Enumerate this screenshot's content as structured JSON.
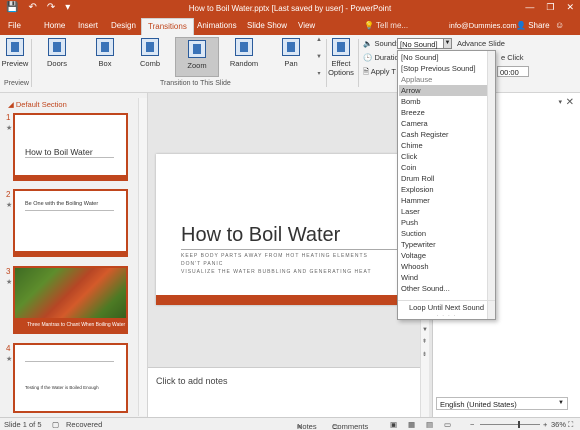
{
  "window": {
    "title": "How to Boil Water.pptx [Last saved by user] - PowerPoint",
    "controls": [
      "—",
      "❐",
      "✕"
    ]
  },
  "qat": {
    "save": "💾",
    "undo": "↶",
    "redo": "↷",
    "customize": "▾"
  },
  "tabs": [
    "File",
    "Home",
    "Insert",
    "Design",
    "Transitions",
    "Animations",
    "Slide Show",
    "View"
  ],
  "active_tab": "Transitions",
  "tell_me": "Tell me...",
  "account_email": "info@Dummies.com",
  "share_label": "Share",
  "ribbon": {
    "preview_label": "Preview",
    "preview_group_label": "Preview",
    "transitions": [
      "Doors",
      "Box",
      "Comb",
      "Zoom",
      "Random",
      "Pan"
    ],
    "selected_transition": "Zoom",
    "effect_options_label": "Effect Options",
    "group_label": "Transition to This Slide",
    "sound_label": "Sound:",
    "sound_value": "[No Sound]",
    "duration_label": "Duration",
    "apply_label": "Apply T",
    "advance_label": "Advance Slide",
    "click_label": "e Click",
    "time_value": "00:00"
  },
  "sound_dropdown": {
    "items": [
      "[No Sound]",
      "[Stop Previous Sound]",
      "Applause",
      "Arrow",
      "Bomb",
      "Breeze",
      "Camera",
      "Cash Register",
      "Chime",
      "Click",
      "Coin",
      "Drum Roll",
      "Explosion",
      "Hammer",
      "Laser",
      "Push",
      "Suction",
      "Typewriter",
      "Voltage",
      "Whoosh",
      "Wind",
      "Other Sound..."
    ],
    "highlighted": "Arrow",
    "loop_label": "Loop Until Next Sound"
  },
  "slides_pane": {
    "section": "Default Section",
    "slides": [
      {
        "num": "1",
        "title": "How to Boil Water"
      },
      {
        "num": "2",
        "title": "Be One with the Boiling Water"
      },
      {
        "num": "3",
        "title": "Three Mantras to Chant When Boiling Water"
      },
      {
        "num": "4",
        "title": "Testing If the Water is Boiled Enough"
      }
    ]
  },
  "current_slide": {
    "title": "How to Boil Water",
    "bullets": [
      "KEEP BODY PARTS AWAY FROM HOT HEATING ELEMENTS",
      "DON'T PANIC",
      "VISUALIZE THE WATER BUBBLING AND GENERATING HEAT"
    ]
  },
  "notes_placeholder": "Click to add notes",
  "language": "English (United States)",
  "statusbar": {
    "slide_info": "Slide 1 of 5",
    "recovered": "Recovered",
    "notes": "Notes",
    "comments": "Comments",
    "zoom_pct": "36%"
  },
  "colors": {
    "accent": "#c0461d",
    "highlight": "#c9c9c9"
  }
}
